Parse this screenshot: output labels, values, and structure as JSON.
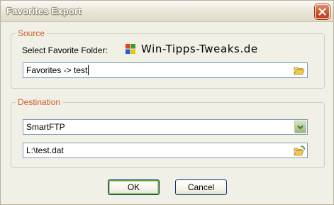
{
  "window": {
    "title": "Favorites Export",
    "close_icon": "close-icon"
  },
  "source": {
    "group_label": "Source",
    "select_label": "Select Favorite Folder:",
    "brand_text": "Win-Tipps-Tweaks.de",
    "brand_icon": "windows-flag-icon",
    "folder_value": "Favorites -> test",
    "browse_icon": "folder-open-icon"
  },
  "destination": {
    "group_label": "Destination",
    "format_value": "SmartFTP",
    "dropdown_icon": "chevron-down-icon",
    "path_value": "L:\\test.dat",
    "browse_icon": "folder-refresh-icon"
  },
  "buttons": {
    "ok_label": "OK",
    "cancel_label": "Cancel"
  },
  "colors": {
    "group_label": "#d25a2a",
    "dialog_bg": "#f0f0e6",
    "close_button": "#cf5a35",
    "ok_focus": "#6f9f3c"
  }
}
